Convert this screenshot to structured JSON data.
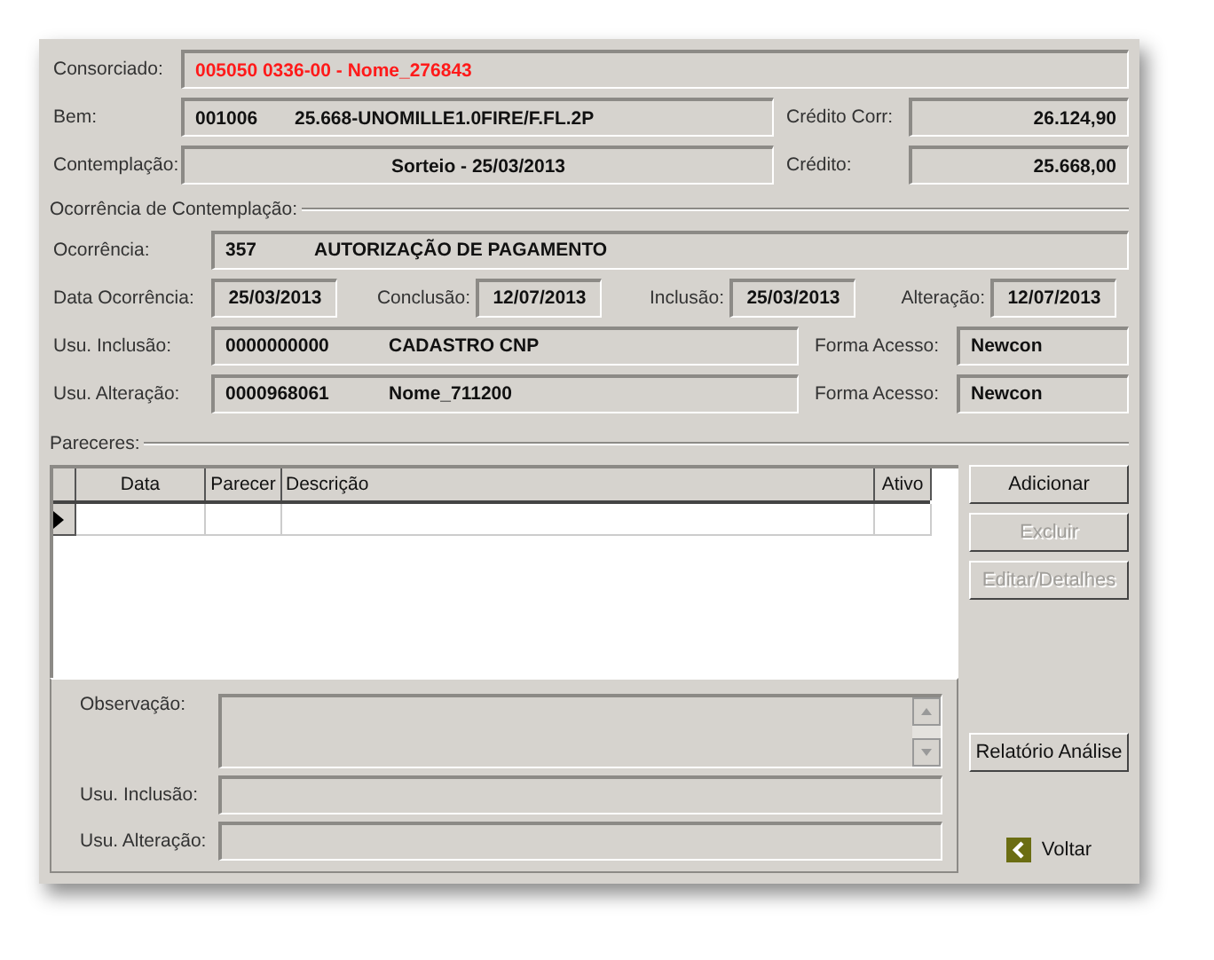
{
  "consorciado": {
    "label": "Consorciado:",
    "value": "005050 0336-00 - Nome_276843"
  },
  "bem": {
    "label": "Bem:",
    "code": "001006",
    "description": "25.668-UNOMILLE1.0FIRE/F.FL.2P"
  },
  "credito_corr": {
    "label": "Crédito Corr:",
    "value": "26.124,90"
  },
  "contemplacao": {
    "label": "Contemplação:",
    "value": "Sorteio - 25/03/2013"
  },
  "credito": {
    "label": "Crédito:",
    "value": "25.668,00"
  },
  "ocorrencia_group": {
    "title": "Ocorrência de Contemplação:",
    "ocorrencia": {
      "label": "Ocorrência:",
      "code": "357",
      "description": "AUTORIZAÇÃO DE PAGAMENTO"
    },
    "dates": [
      {
        "label": "Data Ocorrência:",
        "value": "25/03/2013"
      },
      {
        "label": "Conclusão:",
        "value": "12/07/2013"
      },
      {
        "label": "Inclusão:",
        "value": "25/03/2013"
      },
      {
        "label": "Alteração:",
        "value": "12/07/2013"
      }
    ],
    "users": [
      {
        "label": "Usu. Inclusão:",
        "code": "0000000000",
        "name": "CADASTRO CNP",
        "access_label": "Forma Acesso:",
        "access": "Newcon"
      },
      {
        "label": "Usu. Alteração:",
        "code": "0000968061",
        "name": "Nome_711200",
        "access_label": "Forma Acesso:",
        "access": "Newcon"
      }
    ]
  },
  "pareceres": {
    "title": "Pareceres:",
    "columns": [
      "Data",
      "Parecer",
      "Descrição",
      "Ativo"
    ],
    "observacao_label": "Observação:",
    "usu_inclusao_label": "Usu. Inclusão:",
    "usu_alteracao_label": "Usu. Alteração:"
  },
  "buttons": [
    {
      "label": "Adicionar",
      "disabled": false
    },
    {
      "label": "Excluir",
      "disabled": true
    },
    {
      "label": "Editar/Detalhes",
      "disabled": true
    },
    {
      "label": "Relatório Análise",
      "disabled": false
    }
  ],
  "back": {
    "label": "Voltar"
  }
}
